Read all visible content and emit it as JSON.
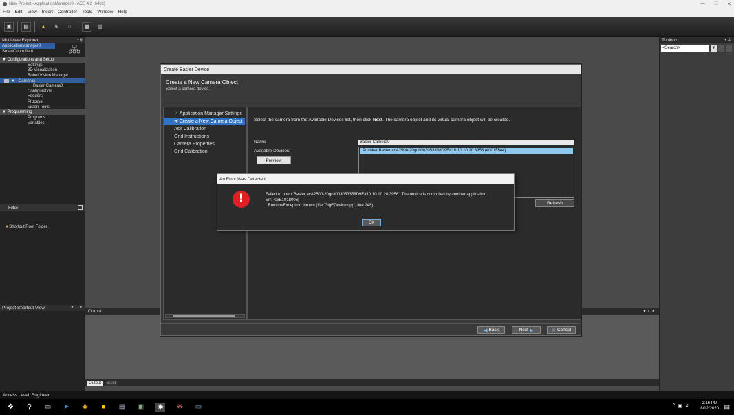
{
  "window": {
    "title": "New Project - ApplicationManager0 - ACE 4.2 (64bit)",
    "min": "—",
    "max": "□",
    "close": "✕"
  },
  "menu": [
    "File",
    "Edit",
    "View",
    "Insert",
    "Controller",
    "Tools",
    "Window",
    "Help"
  ],
  "multiview": {
    "title": "Multiview Explorer",
    "pin": "▾ ȩ",
    "controllers": [
      "ApplicationManager0",
      "SmartController0"
    ],
    "sections": [
      {
        "label": "Configurations and Setup",
        "items": [
          "Settings",
          "3D Visualization",
          "Robot Vision Manager",
          "Cameras",
          "Basler Camera0",
          "Configuration",
          "Feeders",
          "Process",
          "Vision Tools"
        ]
      },
      {
        "label": "Programming",
        "items": [
          "Programs",
          "Variables"
        ]
      }
    ],
    "filter_label": "Filter"
  },
  "shortcut_view": {
    "title": "Project Shortcut View",
    "root": "Shortcut Root Folder"
  },
  "toolbox": {
    "title": "Toolbox",
    "search_placeholder": "<Search>"
  },
  "output": {
    "title": "Output",
    "tabs": [
      "Output",
      "Build"
    ]
  },
  "dialog": {
    "title": "Create Basler Device",
    "heading": "Create a New Camera Object",
    "subheading": "Select a camera device.",
    "steps": [
      {
        "label": "Application Manager Settings",
        "state": "done"
      },
      {
        "label": "Create a New Camera Object",
        "state": "current"
      },
      {
        "label": "Ask Calibration",
        "state": "todo"
      },
      {
        "label": "Grid Instructions",
        "state": "todo"
      },
      {
        "label": "Camera Properties",
        "state": "todo"
      },
      {
        "label": "Grid Calibration",
        "state": "todo"
      }
    ],
    "instruction_pre": "Select the camera from the Available Devices list, then click ",
    "instruction_bold": "Next",
    "instruction_post": ".  The camera object and its virtual camera object will be created.",
    "name_label": "Name",
    "name_value": "Basler Camera0",
    "devices_label": "Available Devices:",
    "device_item": "Pushkar Basler acA2500-20gc#003053358D9E#10.10.10.20:3956 (40015544)",
    "preview": "Preview",
    "refresh": "Refresh",
    "back": "Back",
    "next": "Next",
    "cancel": "Cancel"
  },
  "error": {
    "title": "An Error Was Detected",
    "line1": "Failed to open 'Basler acA2500-20gc#003053358D9E#10.10.10.20:3956'. The device is controlled by another application.",
    "line2": "Err: {0xE1018006}",
    "line3": ": RuntimeException thrown (file 'GigEDevice.cpp', line 248)",
    "ok": "OK"
  },
  "status": "Access Level: Engineer",
  "clock": {
    "time": "2:16 PM",
    "date": "8/12/2020"
  }
}
